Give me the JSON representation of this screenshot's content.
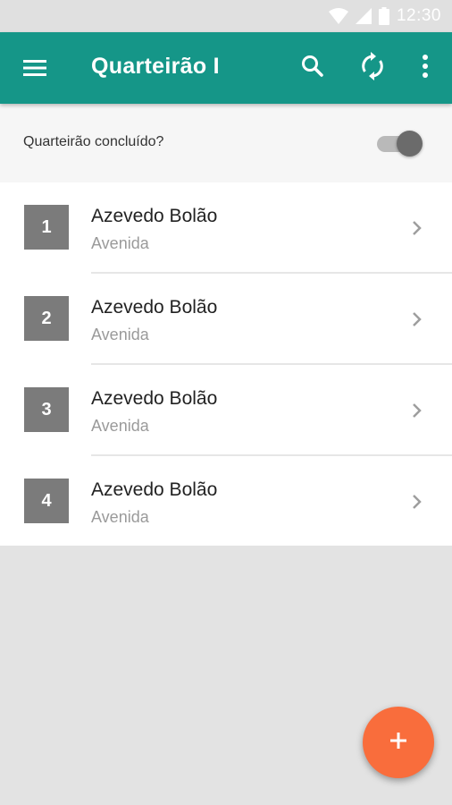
{
  "status_bar": {
    "time": "12:30",
    "icons": [
      "wifi-icon",
      "cell-signal-icon",
      "battery-icon"
    ]
  },
  "app_bar": {
    "title": "Quarteirão I",
    "color": "#159688",
    "actions": [
      "menu-icon",
      "search-icon",
      "sync-icon",
      "more-vert-icon"
    ]
  },
  "toggle": {
    "label": "Quarteirão concluído?",
    "checked": false
  },
  "list": {
    "items": [
      {
        "number": "1",
        "title": "Azevedo Bolão",
        "subtitle": "Avenida"
      },
      {
        "number": "2",
        "title": "Azevedo Bolão",
        "subtitle": "Avenida"
      },
      {
        "number": "3",
        "title": "Azevedo Bolão",
        "subtitle": "Avenida"
      },
      {
        "number": "4",
        "title": "Azevedo Bolão",
        "subtitle": "Avenida"
      }
    ]
  },
  "fab": {
    "icon": "add-icon",
    "color": "#f96d3c"
  }
}
